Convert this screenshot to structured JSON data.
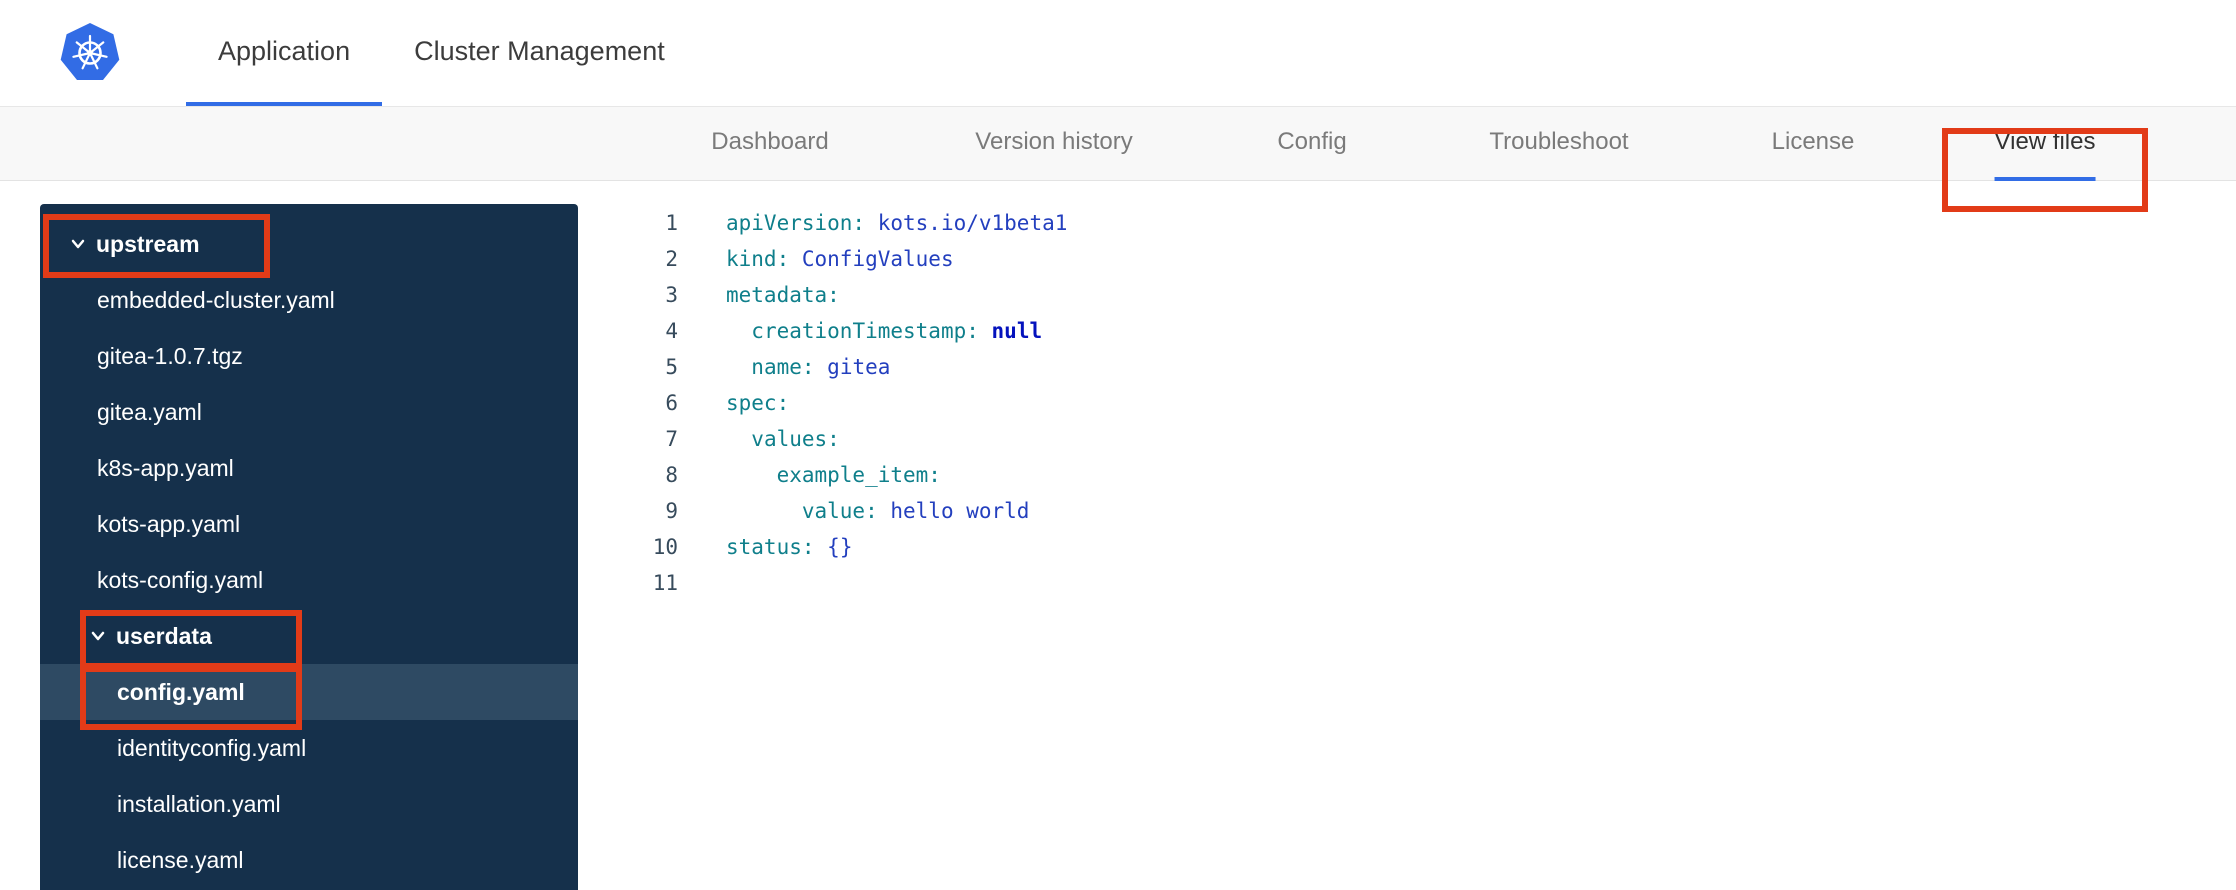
{
  "header": {
    "logo": "kubernetes-logo",
    "tabs": [
      {
        "label": "Application",
        "active": true
      },
      {
        "label": "Cluster Management",
        "active": false
      }
    ]
  },
  "subnav": {
    "items": [
      {
        "label": "Dashboard",
        "active": false
      },
      {
        "label": "Version history",
        "active": false
      },
      {
        "label": "Config",
        "active": false
      },
      {
        "label": "Troubleshoot",
        "active": false
      },
      {
        "label": "License",
        "active": false
      },
      {
        "label": "View files",
        "active": true,
        "annotated": true
      }
    ]
  },
  "file_tree": {
    "items": [
      {
        "label": "upstream",
        "kind": "folder",
        "depth": 0,
        "expanded": true,
        "annotated": true
      },
      {
        "label": "embedded-cluster.yaml",
        "kind": "file",
        "depth": 1
      },
      {
        "label": "gitea-1.0.7.tgz",
        "kind": "file",
        "depth": 1
      },
      {
        "label": "gitea.yaml",
        "kind": "file",
        "depth": 1
      },
      {
        "label": "k8s-app.yaml",
        "kind": "file",
        "depth": 1
      },
      {
        "label": "kots-app.yaml",
        "kind": "file",
        "depth": 1
      },
      {
        "label": "kots-config.yaml",
        "kind": "file",
        "depth": 1
      },
      {
        "label": "userdata",
        "kind": "folder",
        "depth": 1,
        "expanded": true,
        "annotated": true
      },
      {
        "label": "config.yaml",
        "kind": "file",
        "depth": 2,
        "selected": true,
        "annotated": true
      },
      {
        "label": "identityconfig.yaml",
        "kind": "file",
        "depth": 2
      },
      {
        "label": "installation.yaml",
        "kind": "file",
        "depth": 2
      },
      {
        "label": "license.yaml",
        "kind": "file",
        "depth": 2
      }
    ]
  },
  "editor": {
    "language": "yaml",
    "lines": [
      {
        "number": 1,
        "tokens": [
          {
            "text": "apiVersion:",
            "type": "key"
          },
          {
            "text": " ",
            "type": "plain"
          },
          {
            "text": "kots.io/v1beta1",
            "type": "value"
          }
        ]
      },
      {
        "number": 2,
        "tokens": [
          {
            "text": "kind:",
            "type": "key"
          },
          {
            "text": " ",
            "type": "plain"
          },
          {
            "text": "ConfigValues",
            "type": "value"
          }
        ]
      },
      {
        "number": 3,
        "tokens": [
          {
            "text": "metadata:",
            "type": "key"
          }
        ]
      },
      {
        "number": 4,
        "tokens": [
          {
            "text": "  ",
            "type": "plain"
          },
          {
            "text": "creationTimestamp:",
            "type": "key"
          },
          {
            "text": " ",
            "type": "plain"
          },
          {
            "text": "null",
            "type": "constant"
          }
        ]
      },
      {
        "number": 5,
        "tokens": [
          {
            "text": "  ",
            "type": "plain"
          },
          {
            "text": "name:",
            "type": "key"
          },
          {
            "text": " ",
            "type": "plain"
          },
          {
            "text": "gitea",
            "type": "value"
          }
        ]
      },
      {
        "number": 6,
        "tokens": [
          {
            "text": "spec:",
            "type": "key"
          }
        ]
      },
      {
        "number": 7,
        "tokens": [
          {
            "text": "  ",
            "type": "plain"
          },
          {
            "text": "values:",
            "type": "key"
          }
        ]
      },
      {
        "number": 8,
        "tokens": [
          {
            "text": "    ",
            "type": "plain"
          },
          {
            "text": "example_item:",
            "type": "key"
          }
        ]
      },
      {
        "number": 9,
        "tokens": [
          {
            "text": "      ",
            "type": "plain"
          },
          {
            "text": "value:",
            "type": "key"
          },
          {
            "text": " ",
            "type": "plain"
          },
          {
            "text": "hello world",
            "type": "value"
          }
        ]
      },
      {
        "number": 10,
        "tokens": [
          {
            "text": "status:",
            "type": "key"
          },
          {
            "text": " ",
            "type": "plain"
          },
          {
            "text": "{}",
            "type": "value"
          }
        ]
      },
      {
        "number": 11,
        "tokens": []
      }
    ]
  },
  "annotations": {
    "boxes": [
      "view-files-tab",
      "upstream-folder",
      "userdata-folder",
      "config-yaml-file"
    ]
  },
  "colors": {
    "accent_blue": "#326de6",
    "sidebar_bg": "#15304b",
    "sidebar_selected_bg": "#2e4a63",
    "annotation_red": "#e23b18",
    "yaml_key": "#0f7f8b",
    "yaml_value": "#233fbe",
    "yaml_constant": "#0412bd"
  }
}
